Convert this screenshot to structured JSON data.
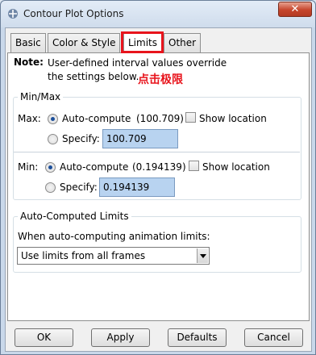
{
  "window": {
    "title": "Contour Plot Options",
    "close_symbol": "✕"
  },
  "tabs": [
    {
      "label": "Basic"
    },
    {
      "label": "Color & Style"
    },
    {
      "label": "Limits"
    },
    {
      "label": "Other"
    }
  ],
  "active_tab": "Limits",
  "note": {
    "label": "Note:",
    "text": "User-defined interval values override the settings below.",
    "annotation": "点击极限"
  },
  "minmax": {
    "title": "Min/Max",
    "max": {
      "label": "Max:",
      "auto_label": "Auto-compute",
      "auto_value": "(100.709)",
      "show_location_label": "Show location",
      "specify_label": "Specify:",
      "specify_value": "100.709"
    },
    "min": {
      "label": "Min:",
      "auto_label": "Auto-compute",
      "auto_value": "(0.194139)",
      "show_location_label": "Show location",
      "specify_label": "Specify:",
      "specify_value": "0.194139"
    }
  },
  "auto_limits": {
    "title": "Auto-Computed Limits",
    "prompt": "When auto-computing animation limits:",
    "selected": "Use limits from all frames"
  },
  "buttons": {
    "ok": "OK",
    "apply": "Apply",
    "defaults": "Defaults",
    "cancel": "Cancel"
  },
  "colors": {
    "highlight": "#e8141c",
    "field_bg": "#b8d3f0"
  }
}
